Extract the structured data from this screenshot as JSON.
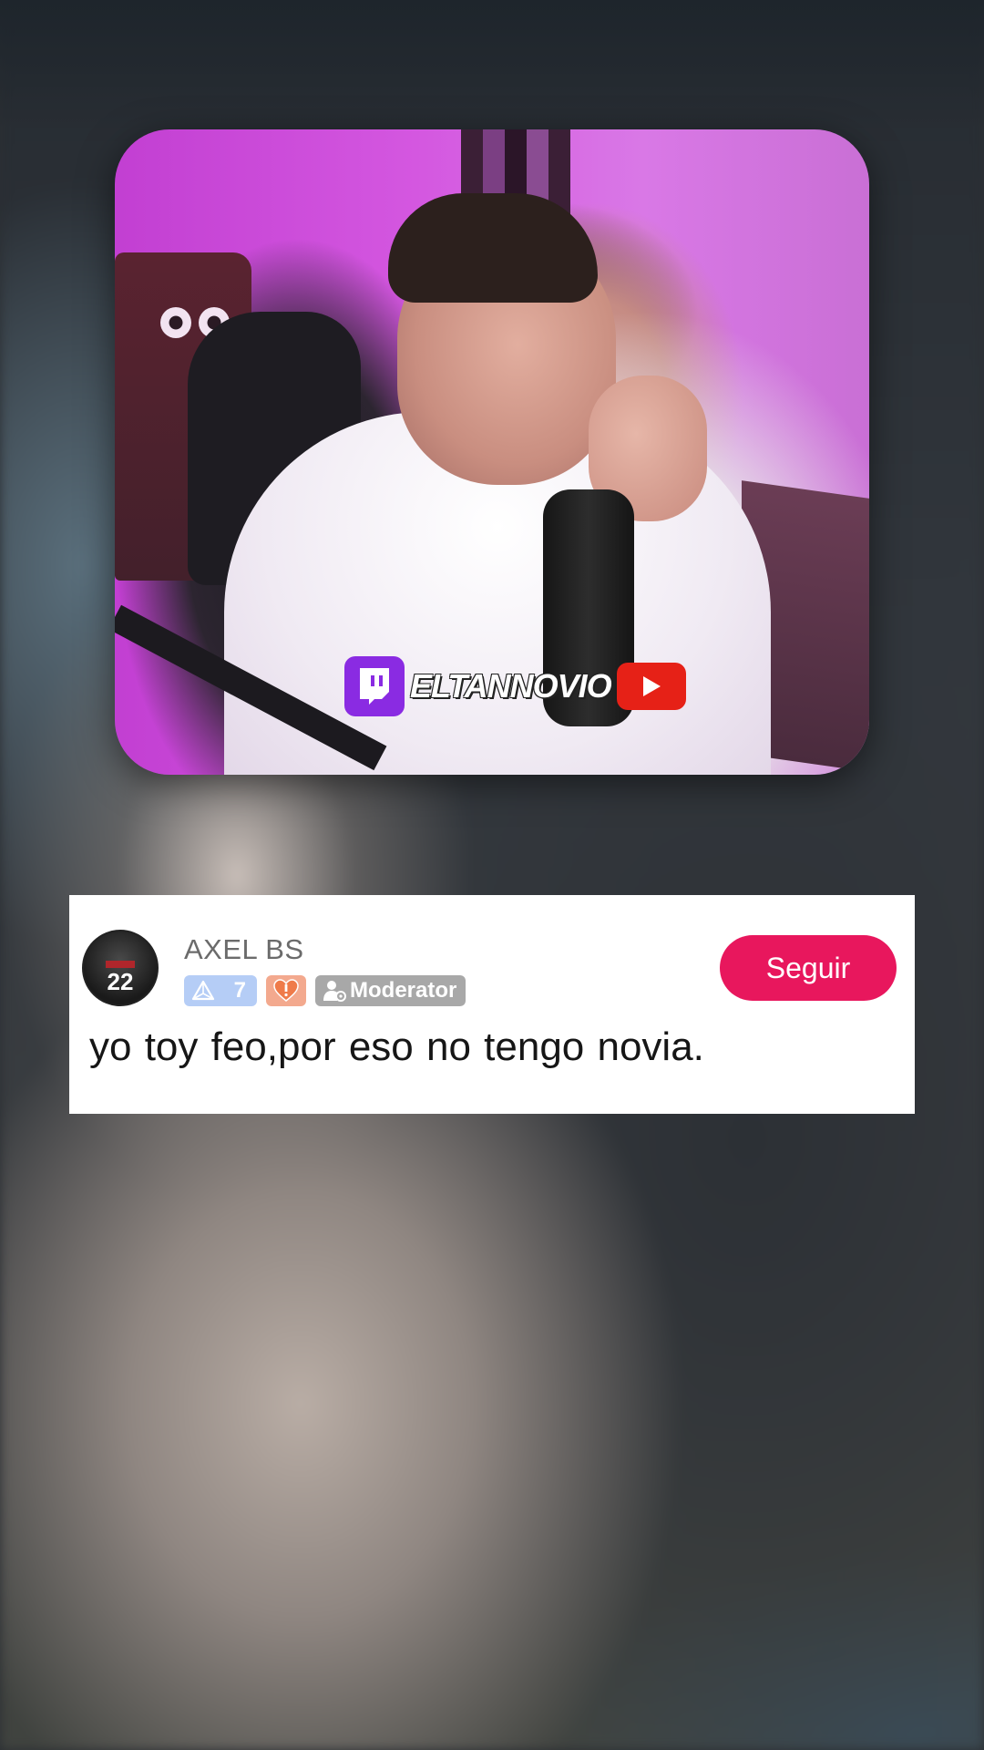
{
  "video": {
    "watermark_text": "ELTANNOVIO",
    "twitch_icon": "twitch-icon",
    "youtube_icon": "youtube-icon"
  },
  "comment": {
    "avatar_number": "22",
    "username": "AXEL BS",
    "level_badge": "7",
    "moderator_badge": "Moderator",
    "follow_label": "Seguir",
    "text": "yo toy feo,por eso no tengo novia."
  },
  "colors": {
    "follow_button": "#e8175d",
    "level_badge": "#b5cdf6",
    "heart_badge": "#f3a98e",
    "moderator_badge": "#a8a8a8",
    "twitch": "#8a2be2",
    "youtube": "#e62117"
  }
}
